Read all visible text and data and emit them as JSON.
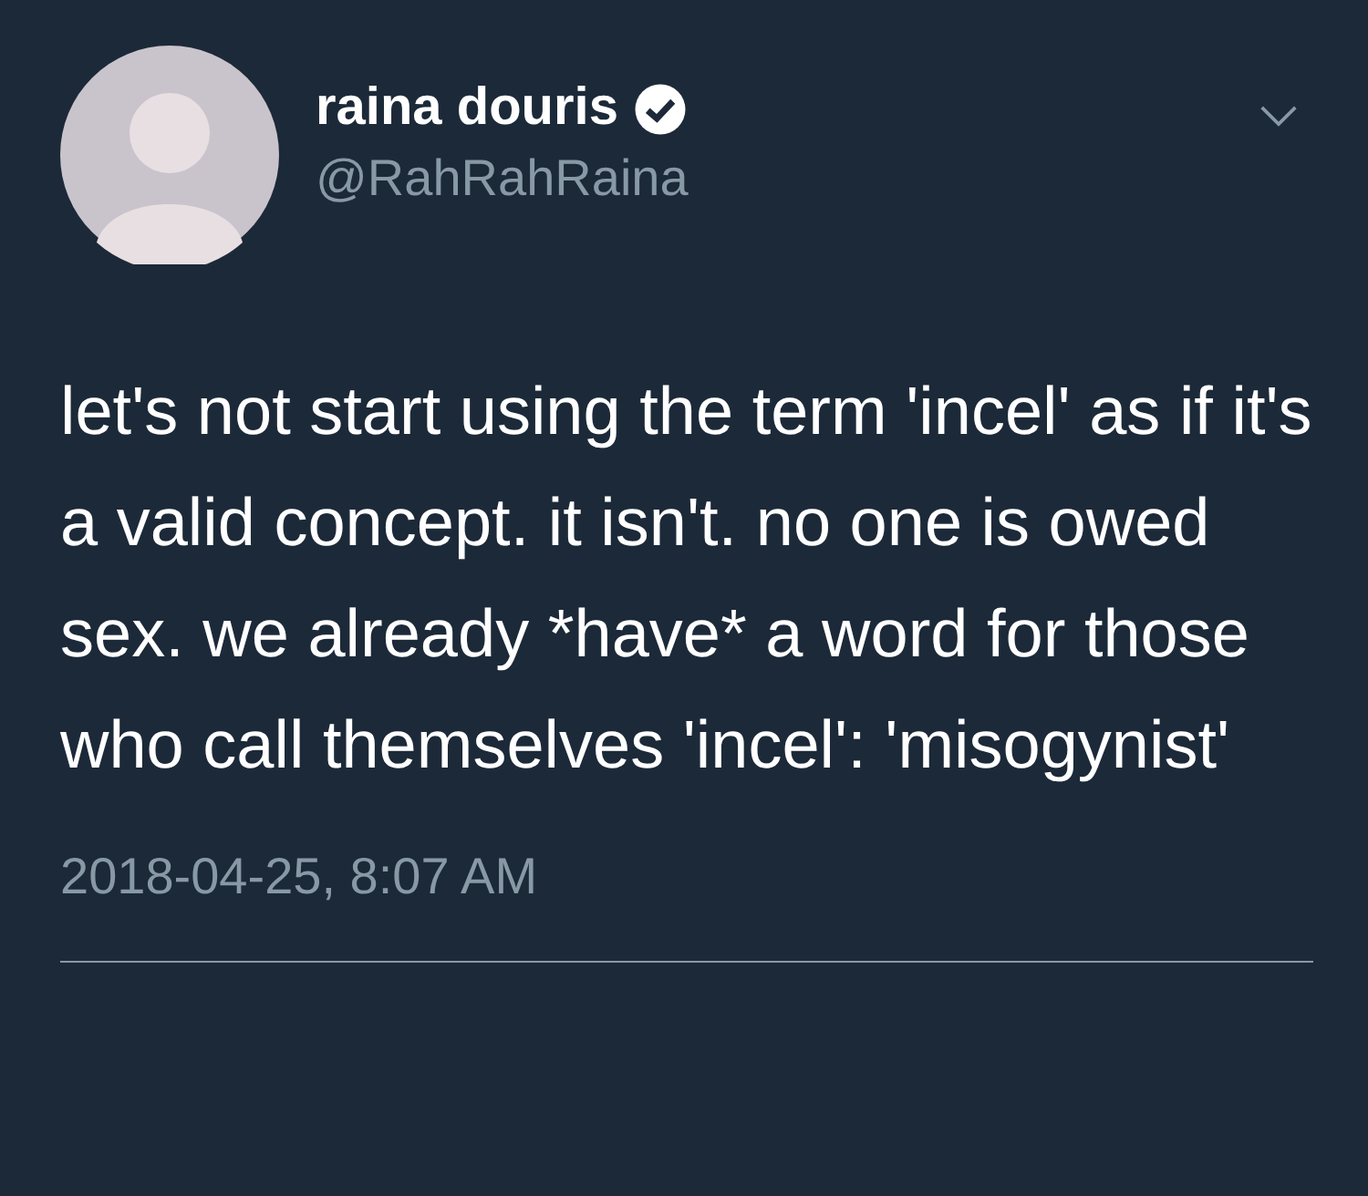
{
  "author": {
    "name": "raina douris",
    "verified": true,
    "handle": "@RahRahRaina"
  },
  "tweet": {
    "text": "let's not start using the term 'incel' as if it's a valid concept. it isn't. no one is owed sex. we already *have* a word for those who call themselves 'incel': 'misogynist'",
    "timestamp": "2018-04-25, 8:07 AM"
  }
}
